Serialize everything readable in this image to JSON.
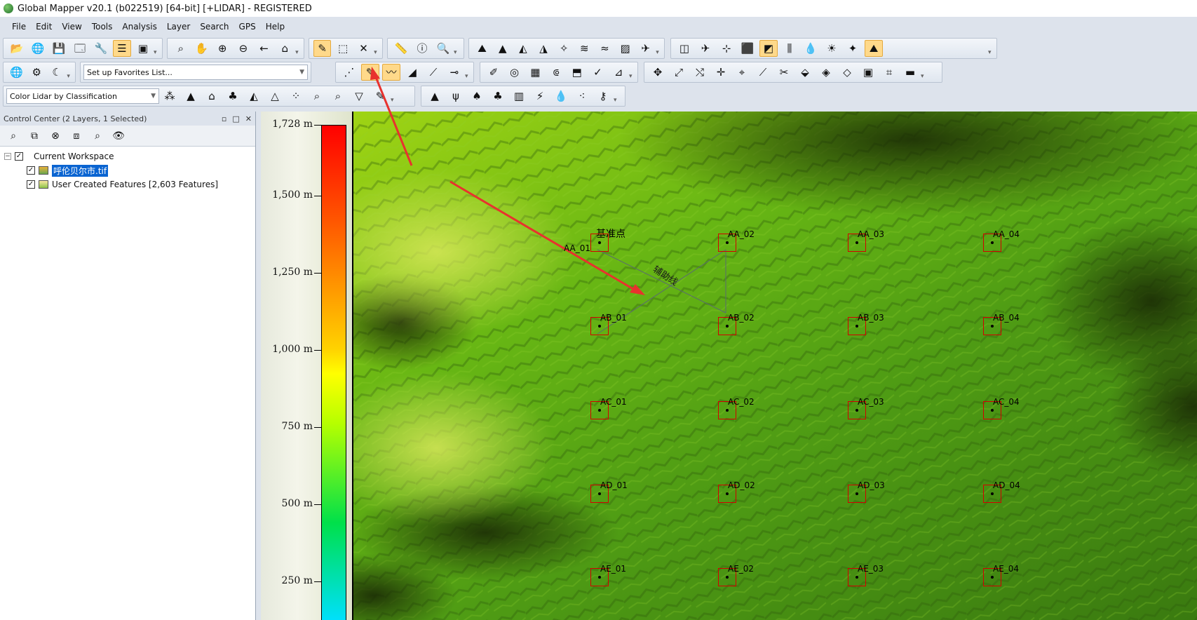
{
  "window": {
    "title": "Global Mapper v20.1 (b022519) [64-bit] [+LIDAR] - REGISTERED"
  },
  "menu": [
    "File",
    "Edit",
    "View",
    "Tools",
    "Analysis",
    "Layer",
    "Search",
    "GPS",
    "Help"
  ],
  "toolbar": {
    "favorites_combo": "Set up Favorites List...",
    "lidar_combo": "Color Lidar by Classification"
  },
  "control_center": {
    "title": "Control Center (2 Layers, 1 Selected)",
    "workspace_label": "Current Workspace",
    "layers": [
      {
        "name": "呼伦贝尔市.tif",
        "checked": true,
        "selected": true
      },
      {
        "name": "User Created Features [2,603 Features]",
        "checked": true,
        "selected": false
      }
    ]
  },
  "legend": {
    "ticks": [
      "1,728 m",
      "1,500 m",
      "1,250 m",
      "1,000 m",
      "750 m",
      "500 m",
      "250 m"
    ]
  },
  "map": {
    "annotation_label": "辅助线",
    "base_point_label": "基准点",
    "rows": [
      [
        "AA_01",
        "AA_02",
        "AA_03",
        "AA_04"
      ],
      [
        "AB_01",
        "AB_02",
        "AB_03",
        "AB_04"
      ],
      [
        "AC_01",
        "AC_02",
        "AC_03",
        "AC_04"
      ],
      [
        "AD_01",
        "AD_02",
        "AD_03",
        "AD_04"
      ],
      [
        "AE_01",
        "AE_02",
        "AE_03",
        "AE_04"
      ]
    ]
  },
  "colors": {
    "arrow": "#e8322e",
    "selection": "#0a64d1",
    "grid_box": "#d40000"
  }
}
